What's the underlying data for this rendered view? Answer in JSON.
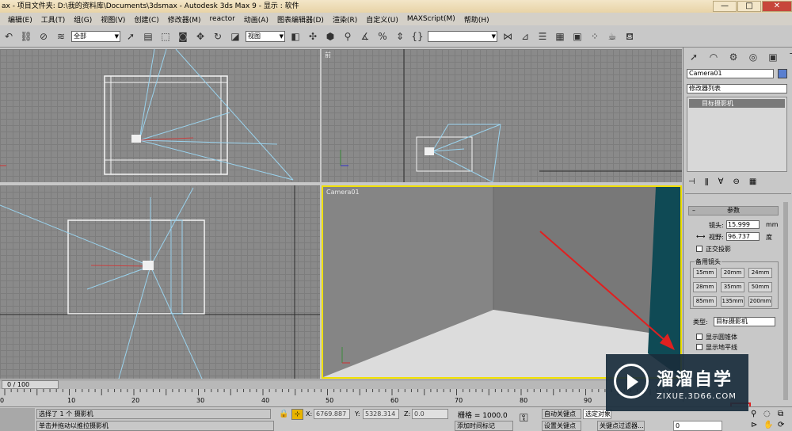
{
  "titlebar": {
    "text": "ax  - 项目文件夹: D:\\我的资料库\\Documents\\3dsmax     - Autodesk 3ds Max 9     - 显示 : 软件"
  },
  "menubar": {
    "items": [
      "编辑(E)",
      "工具(T)",
      "组(G)",
      "视图(V)",
      "创建(C)",
      "修改器(M)",
      "reactor",
      "动画(A)",
      "图表编辑器(D)",
      "渲染(R)",
      "自定义(U)",
      "MAXScript(M)",
      "帮助(H)"
    ]
  },
  "toolbar": {
    "selection_filter": "全部",
    "ref_coord": "视图",
    "named_selection": ""
  },
  "viewports": {
    "top_right_label": "前",
    "bottom_right_label": "Camera01"
  },
  "command_panel": {
    "object_name": "Camera01",
    "modifier_list": "修改器列表",
    "stack_item": "目标摄影机",
    "rollout_title": "参数",
    "lens_label": "镜头:",
    "lens_value": "15.999",
    "lens_unit": "mm",
    "fov_label": "视野:",
    "fov_value": "96.737",
    "fov_unit": "度",
    "ortho_label": "正交投影",
    "stock_lenses_label": "备用镜头",
    "stock_lenses": [
      "15mm",
      "20mm",
      "24mm",
      "28mm",
      "35mm",
      "50mm",
      "85mm",
      "135mm",
      "200mm"
    ],
    "type_label": "类型:",
    "type_value": "目标摄影机",
    "show_cone": "显示圆锥体",
    "show_horizon": "显示地平线"
  },
  "timeline": {
    "frame": "0 / 100",
    "ticks": [
      "0",
      "10",
      "20",
      "30",
      "40",
      "50",
      "60",
      "70",
      "80",
      "90"
    ]
  },
  "status": {
    "selected": "选择了 1 个 摄影机",
    "hint": "单击并拖动以推拉摄影机",
    "x_label": "X:",
    "x_value": "6769.887",
    "y_label": "Y:",
    "y_value": "5328.314",
    "z_label": "Z:",
    "z_value": "0.0",
    "grid": "栅格 = 1000.0",
    "add_time_tag": "添加时间标记",
    "auto_key": "自动关键点",
    "selected_object": "选定对象",
    "set_key": "设置关键点",
    "key_filters": "关键点过滤器...",
    "current_frame": "0"
  },
  "watermark": {
    "brand": "溜溜自学",
    "url": "ZIXUE.3D66.COM"
  },
  "colors": {
    "annotation_arrow": "#e02020",
    "active_viewport_border": "#f0e000",
    "camera_cone": "#9ad3ee"
  }
}
